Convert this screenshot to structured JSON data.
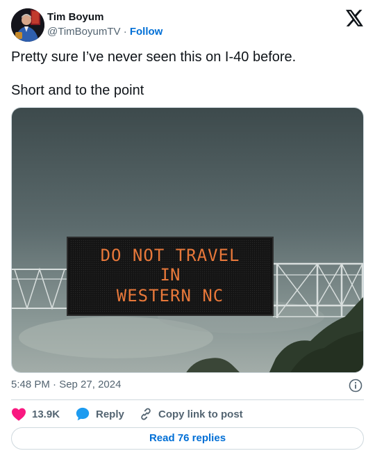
{
  "author": {
    "name": "Tim Boyum",
    "handle": "@TimBoyumTV",
    "separator": "·",
    "follow_label": "Follow"
  },
  "tweet": {
    "paragraphs": [
      "Pretty sure I’ve never seen this on I-40 before.",
      "Short and to the point"
    ],
    "timestamp": "5:48 PM · Sep 27, 2024"
  },
  "media": {
    "sign_lines": [
      "DO NOT TRAVEL",
      "IN",
      "WESTERN NC"
    ]
  },
  "actions": {
    "likes_count": "13.9K",
    "reply_label": "Reply",
    "copy_link_label": "Copy link to post"
  },
  "footer": {
    "read_replies_label": "Read 76 replies"
  },
  "colors": {
    "like": "#f91880",
    "reply": "#1d9bf0",
    "link": "#006fd6",
    "muted": "#536471",
    "sign_text": "#e8783a"
  },
  "icons": [
    "x-logo-icon",
    "heart-icon",
    "reply-bubble-icon",
    "link-icon",
    "info-icon"
  ]
}
